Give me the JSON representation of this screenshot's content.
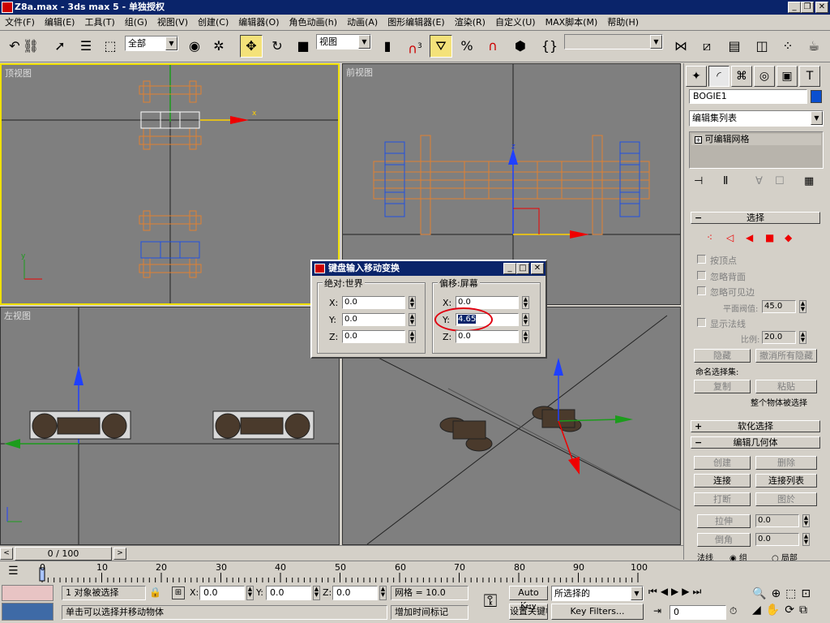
{
  "window": {
    "title": "Z8a.max - 3ds max 5 - 单独授权"
  },
  "menu": [
    "文件(F)",
    "编辑(E)",
    "工具(T)",
    "组(G)",
    "视图(V)",
    "创建(C)",
    "编辑器(O)",
    "角色动画(h)",
    "动画(A)",
    "图形编辑器(E)",
    "渲染(R)",
    "自定义(U)",
    "MAX脚本(M)",
    "帮助(H)"
  ],
  "toolbar": {
    "selection_filter": "全部",
    "ref_coord": "视图",
    "snap_label": "3"
  },
  "viewports": {
    "top": "顶视图",
    "front": "前视图",
    "left": "左视图",
    "persp": ""
  },
  "axes": {
    "x": "x",
    "y": "y",
    "z": "z"
  },
  "command_panel": {
    "object_name": "BOGIE1",
    "object_color": "#0a4fd0",
    "modifier_list": "编辑集列表",
    "stack_item": "可编辑网格",
    "selection": {
      "title": "选择",
      "by_vertex": "按顶点",
      "ignore_backfacing": "忽略背面",
      "ignore_visible": "忽略可见边",
      "planar_thresh_label": "平面阀值:",
      "planar_thresh_value": "45.0",
      "show_normals": "显示法线",
      "scale_label": "比例:",
      "scale_value": "20.0",
      "hide": "隐藏",
      "unhide_all": "撤消所有隐藏",
      "named_sel": "命名选择集:",
      "copy": "复制",
      "paste": "粘贴",
      "whole_object": "整个物体被选择"
    },
    "soft_selection": "软化选择",
    "edit_geometry": {
      "title": "编辑几何体",
      "create": "创建",
      "delete": "删除",
      "attach": "连接",
      "attach_list": "连接列表",
      "break": "打断",
      "detach": "图於",
      "extrude": "拉伸",
      "extrude_value": "0.0",
      "chamfer": "倒角",
      "chamfer_value": "0.0",
      "normal_label": "法线",
      "group_option": "组",
      "local_option": "局部"
    }
  },
  "dialog": {
    "title": "键盘输入移动变换",
    "absolute_title": "绝对:世界",
    "offset_title": "偏移:屏幕",
    "x_label": "X:",
    "y_label": "Y:",
    "z_label": "Z:",
    "abs_x": "0.0",
    "abs_y": "0.0",
    "abs_z": "0.0",
    "off_x": "0.0",
    "off_y": "4.65",
    "off_z": "0.0"
  },
  "timeline": {
    "slider": "0 / 100",
    "ticks": [
      "0",
      "10",
      "20",
      "30",
      "40",
      "50",
      "60",
      "70",
      "80",
      "90",
      "100"
    ]
  },
  "status": {
    "selected": "1 对象被选择",
    "x_label": "X:",
    "x_value": "0.0",
    "y_label": "Y:",
    "y_value": "0.0",
    "z_label": "Z:",
    "z_value": "0.0",
    "grid": "网格 = 10.0",
    "prompt": "单击可以选择并移动物体",
    "add_time_tag": "增加时间标记",
    "auto_key": "Auto Key",
    "set_key": "设置关键帧",
    "key_filter_combo": "所选择的",
    "key_filters": "Key Filters...",
    "frame": "0"
  },
  "colors": {
    "viewport_bg": "#7f7f7f",
    "active_border": "#f0e000",
    "titlebar": "#0a246a",
    "wire_orange": "#e08030",
    "wire_blue": "#2050e0"
  }
}
